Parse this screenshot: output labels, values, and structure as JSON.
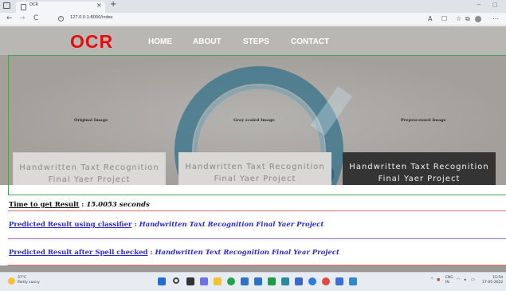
{
  "browser": {
    "tab_title": "OCR",
    "tab_close": "×",
    "new_tab": "+",
    "min_ctl": "−",
    "max_ctl": "▢",
    "back": "←",
    "forward": "→",
    "reload": "C",
    "info": "i",
    "url": "127.0.0.1:8000/index",
    "icons": [
      "lock-icon",
      "read-aloud-icon",
      "favorites-icon",
      "collections-icon",
      "profile-icon"
    ]
  },
  "site": {
    "logo": "OCR",
    "nav": [
      "HOME",
      "ABOUT",
      "STEPS",
      "CONTACT"
    ]
  },
  "images": {
    "original_label": "Original Image",
    "gray_label": "Gray scaled Image",
    "pre_label": "Preprocessed Image",
    "handwritten_line1": "Handwritten Taxt Recognition",
    "handwritten_line2": "Final Yaer Project"
  },
  "results": {
    "time_label": "Time to get Result",
    "time_value": "15.0053 seconds",
    "predicted_label": "Predicted Result using classifier",
    "predicted_value": "Handwritten Taxt Recognition Final Yaer Project",
    "spell_label": "Predicted Result after Spell checked",
    "spell_value": "Handwritten Text Recognition Final Year Project",
    "separator": ":"
  },
  "taskbar": {
    "weather_temp": "37°C",
    "weather_desc": "Partly sunny",
    "lang": "ENG",
    "lang_sub": "IN",
    "time": "15:54",
    "date": "17-05-2022"
  },
  "colors": {
    "logo": "#e60c0c",
    "header_bg": "#b9b7b4",
    "result_link": "#2b2bc8",
    "result_time": "#111111",
    "line_red": "#e07070",
    "line_purple": "#9b6fb0",
    "frame_green": "#4aa34a"
  }
}
